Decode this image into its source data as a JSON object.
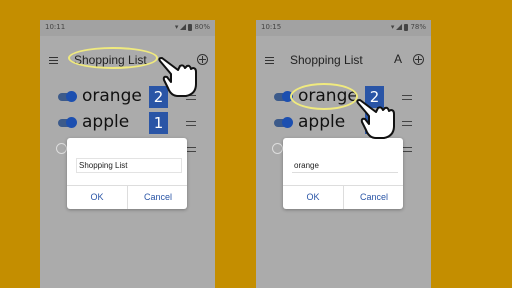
{
  "screens": [
    {
      "status": {
        "time": "10:11",
        "battery": "80%"
      },
      "toolbar": {
        "title": "Shopping List",
        "sort_label": ""
      },
      "items": [
        {
          "name": "orange",
          "qty": "2",
          "checked": true
        },
        {
          "name": "apple",
          "qty": "1",
          "checked": true
        },
        {
          "name": "",
          "qty": "",
          "checked": false
        }
      ],
      "dialog": {
        "input_value": "Shopping List",
        "ok_label": "OK",
        "cancel_label": "Cancel"
      }
    },
    {
      "status": {
        "time": "10:15",
        "battery": "78%"
      },
      "toolbar": {
        "title": "Shopping List",
        "sort_label": "A"
      },
      "items": [
        {
          "name": "orange",
          "qty": "2",
          "checked": true
        },
        {
          "name": "apple",
          "qty": "1",
          "checked": true
        },
        {
          "name": "",
          "qty": "",
          "checked": false
        }
      ],
      "dialog": {
        "input_value": "orange",
        "ok_label": "OK",
        "cancel_label": "Cancel"
      }
    }
  ],
  "colors": {
    "background": "#c48e00",
    "accent": "#2a55a6",
    "highlight": "#f0ea7e"
  },
  "icons": [
    "menu-icon",
    "add-circle-icon",
    "drag-handle-icon",
    "pointing-hand-icon",
    "wifi-icon",
    "signal-icon",
    "battery-icon"
  ]
}
